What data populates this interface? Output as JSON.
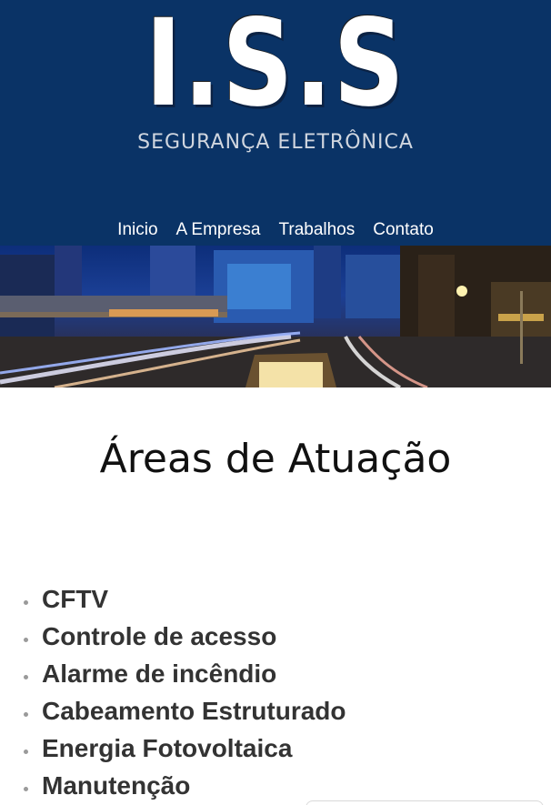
{
  "logo": {
    "letters": "I.S.S",
    "subtitle": "SEGURANÇA ELETRÔNICA"
  },
  "nav": {
    "items": [
      "Inicio",
      "A Empresa",
      "Trabalhos",
      "Contato"
    ]
  },
  "banner": {
    "icon": "city-night-image"
  },
  "main": {
    "heading": "Áreas de Atuação",
    "areas": [
      "CFTV",
      "Controle de acesso",
      "Alarme de incêndio",
      "Cabeamento Estruturado",
      "Energia Fotovoltaica",
      "Manutenção"
    ]
  },
  "colors": {
    "header_bg": "#0a3366",
    "nav_text": "#ffffff",
    "heading_text": "#111111",
    "list_text": "#333333",
    "bullet": "#9a9a9a"
  }
}
